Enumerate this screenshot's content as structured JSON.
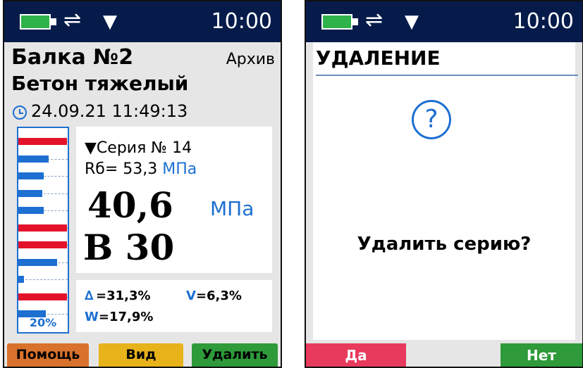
{
  "status": {
    "time": "10:00",
    "usb_glyph": "⇌",
    "signal_glyph": "▼"
  },
  "screen1": {
    "title": "Балка №2",
    "archive": "Архив",
    "material": "Бетон тяжелый",
    "date": "24.09.21  11:49:13",
    "series": "▼Серия № 14",
    "rb_label": "Rб= 53,3",
    "rb_unit": "МПа",
    "strength": "40,6",
    "strength_unit": "МПа",
    "class": "В 30",
    "delta": "=31,3%",
    "v": "V=6,3%",
    "w": "W=17,9%",
    "bar_percent": "20%",
    "bars": [
      {
        "color": "#e3122a",
        "fill": 0.98
      },
      {
        "color": "#1d6fd1",
        "fill": 0.62
      },
      {
        "color": "#1d6fd1",
        "fill": 0.52
      },
      {
        "color": "#1d6fd1",
        "fill": 0.48
      },
      {
        "color": "#1d6fd1",
        "fill": 0.52
      },
      {
        "color": "#e3122a",
        "fill": 0.98
      },
      {
        "color": "#e3122a",
        "fill": 0.98
      },
      {
        "color": "#1d6fd1",
        "fill": 0.78
      },
      {
        "color": "#1d6fd1",
        "fill": 0.12
      },
      {
        "color": "#e3122a",
        "fill": 0.98
      },
      {
        "color": "#1d6fd1",
        "fill": 0.55
      }
    ],
    "buttons": {
      "help": "Помощь",
      "view": "Вид",
      "delete": "Удалить"
    }
  },
  "screen2": {
    "title": "УДАЛЕНИЕ",
    "question": "Удалить серию?",
    "yes": "Да",
    "no": "Нет"
  },
  "colors": {
    "status_bar": "#061b4a",
    "accent_blue": "#1d6fd1",
    "bar_red": "#e3122a",
    "help_btn": "#d9722c",
    "view_btn": "#e7b21a",
    "green_btn": "#2e9a3a",
    "yes_btn": "#e83a5c"
  }
}
